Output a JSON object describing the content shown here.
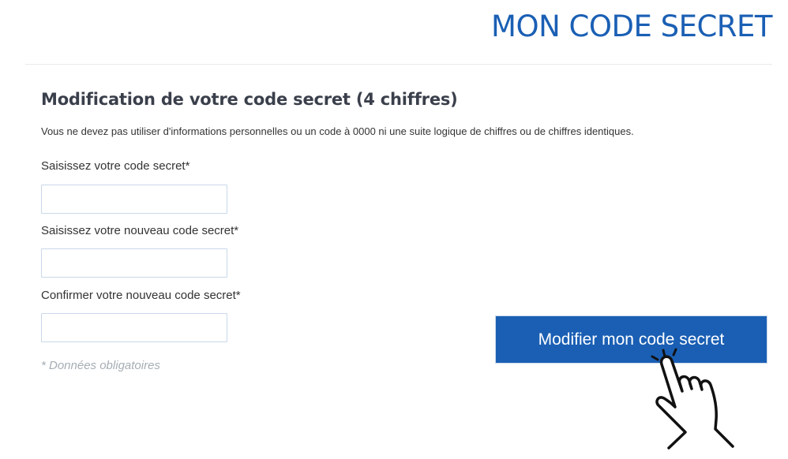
{
  "header": {
    "title": "MON CODE SECRET"
  },
  "form": {
    "section_title": "Modification de votre code secret (4 chiffres)",
    "instructions": "Vous ne devez pas utiliser d'informations personnelles ou un code à 0000 ni une suite logique de chiffres ou de chiffres identiques.",
    "fields": [
      {
        "label": "Saisissez votre code secret*",
        "value": ""
      },
      {
        "label": "Saisissez votre nouveau code secret*",
        "value": ""
      },
      {
        "label": "Confirmer votre nouveau code secret*",
        "value": ""
      }
    ],
    "required_note": "* Données obligatoires",
    "submit_label": "Modifier mon code secret"
  },
  "icons": {
    "cursor": "hand-pointer-icon"
  },
  "colors": {
    "brand": "#1a5fb4",
    "input_border": "#c9d8ea",
    "muted_text": "#a6adb4"
  }
}
